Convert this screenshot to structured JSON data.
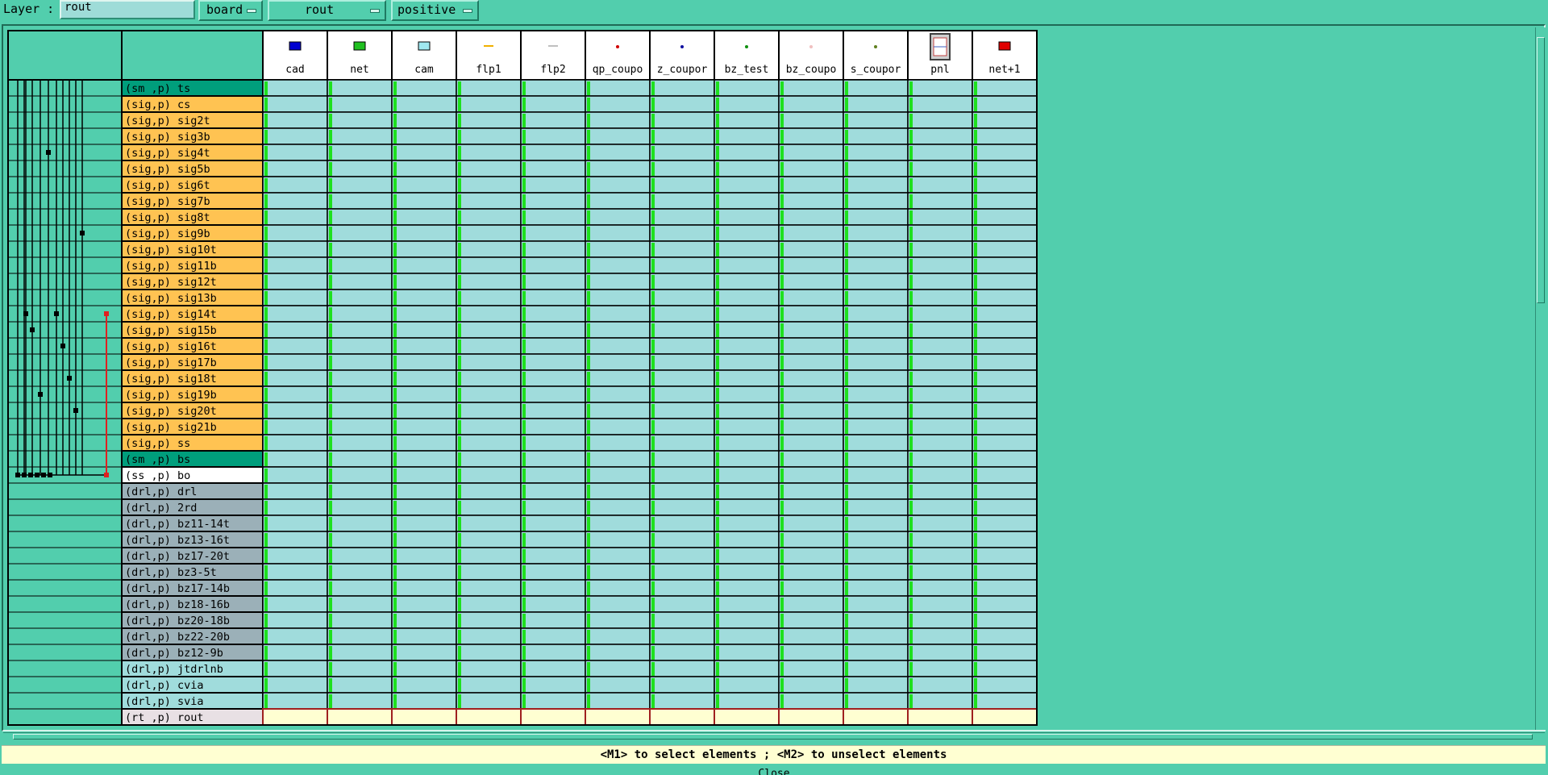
{
  "toolbar": {
    "layer_label": "Layer :",
    "layer_value": "rout",
    "dropdowns": [
      "board",
      "rout",
      "positive"
    ]
  },
  "columns": [
    {
      "name": "cad",
      "icon": "blue-swatch-icon",
      "color": "#0000d0"
    },
    {
      "name": "net",
      "icon": "green-swatch-icon",
      "color": "#20c020"
    },
    {
      "name": "cam",
      "icon": "cyan-swatch-icon",
      "color": "#a0e8f0"
    },
    {
      "name": "flp1",
      "icon": "orange-dash-icon",
      "color": "#f0b000"
    },
    {
      "name": "flp2",
      "icon": "gray-dash-icon",
      "color": "#c0c0c0"
    },
    {
      "name": "qp_coupo",
      "icon": "red-dot-icon",
      "color": "#d00000"
    },
    {
      "name": "z_coupor",
      "icon": "blue-dot-icon",
      "color": "#1010a0"
    },
    {
      "name": "bz_test",
      "icon": "green-dot-icon",
      "color": "#109010"
    },
    {
      "name": "bz_coupo",
      "icon": "pale-dot-icon",
      "color": "#f0c0c0"
    },
    {
      "name": "s_coupor",
      "icon": "olive-dot-icon",
      "color": "#608020"
    },
    {
      "name": "pnl",
      "icon": "panel-icon",
      "color": "#808080"
    },
    {
      "name": "net+1",
      "icon": "red-swatch-icon",
      "color": "#e00000"
    }
  ],
  "rows": [
    {
      "label": "(sm ,p) ts",
      "type": "sm"
    },
    {
      "label": "(sig,p) cs",
      "type": "sig"
    },
    {
      "label": "(sig,p) sig2t",
      "type": "sig"
    },
    {
      "label": "(sig,p) sig3b",
      "type": "sig"
    },
    {
      "label": "(sig,p) sig4t",
      "type": "sig"
    },
    {
      "label": "(sig,p) sig5b",
      "type": "sig"
    },
    {
      "label": "(sig,p) sig6t",
      "type": "sig"
    },
    {
      "label": "(sig,p) sig7b",
      "type": "sig"
    },
    {
      "label": "(sig,p) sig8t",
      "type": "sig"
    },
    {
      "label": "(sig,p) sig9b",
      "type": "sig"
    },
    {
      "label": "(sig,p) sig10t",
      "type": "sig"
    },
    {
      "label": "(sig,p) sig11b",
      "type": "sig"
    },
    {
      "label": "(sig,p) sig12t",
      "type": "sig"
    },
    {
      "label": "(sig,p) sig13b",
      "type": "sig"
    },
    {
      "label": "(sig,p) sig14t",
      "type": "sig"
    },
    {
      "label": "(sig,p) sig15b",
      "type": "sig"
    },
    {
      "label": "(sig,p) sig16t",
      "type": "sig"
    },
    {
      "label": "(sig,p) sig17b",
      "type": "sig"
    },
    {
      "label": "(sig,p) sig18t",
      "type": "sig"
    },
    {
      "label": "(sig,p) sig19b",
      "type": "sig"
    },
    {
      "label": "(sig,p) sig20t",
      "type": "sig"
    },
    {
      "label": "(sig,p) sig21b",
      "type": "sig"
    },
    {
      "label": "(sig,p) ss",
      "type": "sig"
    },
    {
      "label": "(sm ,p) bs",
      "type": "sm"
    },
    {
      "label": "(ss ,p) bo",
      "type": "ss"
    },
    {
      "label": "(drl,p) drl",
      "type": "drl"
    },
    {
      "label": "(drl,p) 2rd",
      "type": "drl"
    },
    {
      "label": "(drl,p) bz11-14t",
      "type": "drl"
    },
    {
      "label": "(drl,p) bz13-16t",
      "type": "drl"
    },
    {
      "label": "(drl,p) bz17-20t",
      "type": "drl"
    },
    {
      "label": "(drl,p) bz3-5t",
      "type": "drl"
    },
    {
      "label": "(drl,p) bz17-14b",
      "type": "drl"
    },
    {
      "label": "(drl,p) bz18-16b",
      "type": "drl"
    },
    {
      "label": "(drl,p) bz20-18b",
      "type": "drl"
    },
    {
      "label": "(drl,p) bz22-20b",
      "type": "drl"
    },
    {
      "label": "(drl,p) bz12-9b",
      "type": "drl"
    },
    {
      "label": "(drl,p) jtdrlnb",
      "type": "drl2"
    },
    {
      "label": "(drl,p) cvia",
      "type": "drl2"
    },
    {
      "label": "(drl,p) svia",
      "type": "drl2"
    },
    {
      "label": "(rt ,p) rout",
      "type": "rt"
    }
  ],
  "colors": {
    "sm": "#009e7c",
    "sig": "#ffc352",
    "ss": "#ffffff",
    "drl": "#9bb0b8",
    "drl2": "#a0dcdc",
    "rt": "#e8e0e4",
    "cell": "#a0dcdc",
    "cell_rout": "#ffffd2",
    "green_marker": "#1ee01e"
  },
  "hint": "<M1> to select elements ; <M2> to unselect elements",
  "close_label": "Close"
}
